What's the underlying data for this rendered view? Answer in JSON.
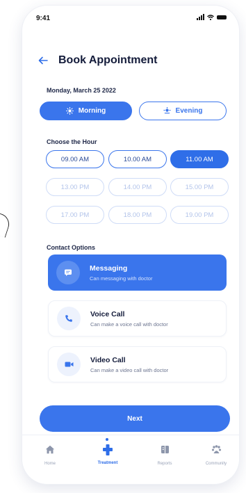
{
  "status_bar": {
    "time": "9:41"
  },
  "header": {
    "back_icon": "arrow-left-icon",
    "title": "Book Appointment"
  },
  "date_label": "Monday, March 25 2022",
  "period": {
    "options": [
      {
        "label": "Morning",
        "icon": "sun-icon",
        "selected": true
      },
      {
        "label": "Evening",
        "icon": "moon-icon",
        "selected": false
      }
    ]
  },
  "hours": {
    "label": "Choose the Hour",
    "slots": [
      {
        "label": "09.00 AM",
        "state": "available"
      },
      {
        "label": "10.00 AM",
        "state": "available"
      },
      {
        "label": "11.00 AM",
        "state": "selected"
      },
      {
        "label": "13.00 PM",
        "state": "unavailable"
      },
      {
        "label": "14.00 PM",
        "state": "unavailable"
      },
      {
        "label": "15.00 PM",
        "state": "unavailable"
      },
      {
        "label": "17.00 PM",
        "state": "unavailable"
      },
      {
        "label": "18.00 PM",
        "state": "unavailable"
      },
      {
        "label": "19.00 PM",
        "state": "unavailable"
      }
    ]
  },
  "contact": {
    "label": "Contact Options",
    "options": [
      {
        "title": "Messaging",
        "subtitle": "Can messaging with doctor",
        "icon": "chat-icon",
        "selected": true
      },
      {
        "title": "Voice Call",
        "subtitle": "Can make a voice call with doctor",
        "icon": "phone-icon",
        "selected": false
      },
      {
        "title": "Video Call",
        "subtitle": "Can make a video call with doctor",
        "icon": "video-icon",
        "selected": false
      }
    ]
  },
  "next_label": "Next",
  "tabs": [
    {
      "label": "Home",
      "icon": "home-icon",
      "active": false
    },
    {
      "label": "Treatment",
      "icon": "medical-cross-icon",
      "active": true
    },
    {
      "label": "Reports",
      "icon": "report-icon",
      "active": false
    },
    {
      "label": "Community",
      "icon": "community-icon",
      "active": false
    }
  ],
  "colors": {
    "accent": "#3a75ec",
    "text": "#131b3a",
    "muted": "#9aa3b8",
    "disabled": "#b3c4ea"
  }
}
